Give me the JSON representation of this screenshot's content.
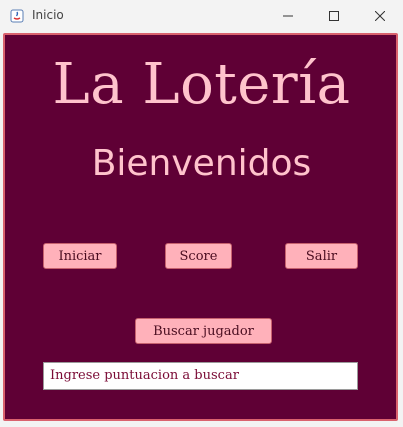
{
  "window": {
    "title": "Inicio"
  },
  "main": {
    "title": "La Lotería",
    "subtitle": "Bienvenidos"
  },
  "buttons": {
    "iniciar": "Iniciar",
    "score": "Score",
    "salir": "Salir",
    "buscar": "Buscar jugador"
  },
  "search": {
    "value": "Ingrese puntuacion a buscar"
  },
  "colors": {
    "background": "#5f0035",
    "border": "#d9626e",
    "title_text": "#ffc3cc",
    "button": "#ffb1ba",
    "input_text": "#7a0a35"
  }
}
